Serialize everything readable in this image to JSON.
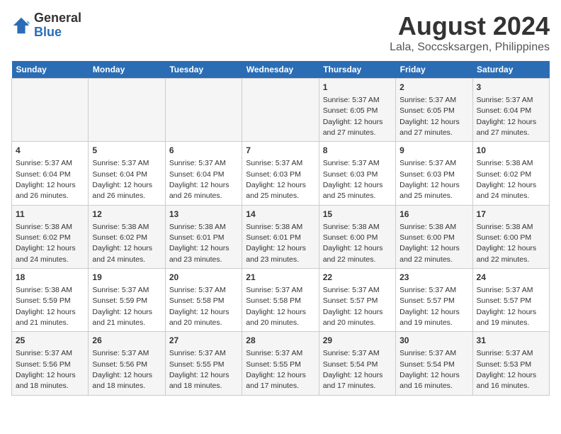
{
  "header": {
    "logo_general": "General",
    "logo_blue": "Blue",
    "title": "August 2024",
    "subtitle": "Lala, Soccsksargen, Philippines"
  },
  "weekdays": [
    "Sunday",
    "Monday",
    "Tuesday",
    "Wednesday",
    "Thursday",
    "Friday",
    "Saturday"
  ],
  "weeks": [
    [
      {
        "day": "",
        "info": ""
      },
      {
        "day": "",
        "info": ""
      },
      {
        "day": "",
        "info": ""
      },
      {
        "day": "",
        "info": ""
      },
      {
        "day": "1",
        "info": "Sunrise: 5:37 AM\nSunset: 6:05 PM\nDaylight: 12 hours and 27 minutes."
      },
      {
        "day": "2",
        "info": "Sunrise: 5:37 AM\nSunset: 6:05 PM\nDaylight: 12 hours and 27 minutes."
      },
      {
        "day": "3",
        "info": "Sunrise: 5:37 AM\nSunset: 6:04 PM\nDaylight: 12 hours and 27 minutes."
      }
    ],
    [
      {
        "day": "4",
        "info": "Sunrise: 5:37 AM\nSunset: 6:04 PM\nDaylight: 12 hours and 26 minutes."
      },
      {
        "day": "5",
        "info": "Sunrise: 5:37 AM\nSunset: 6:04 PM\nDaylight: 12 hours and 26 minutes."
      },
      {
        "day": "6",
        "info": "Sunrise: 5:37 AM\nSunset: 6:04 PM\nDaylight: 12 hours and 26 minutes."
      },
      {
        "day": "7",
        "info": "Sunrise: 5:37 AM\nSunset: 6:03 PM\nDaylight: 12 hours and 25 minutes."
      },
      {
        "day": "8",
        "info": "Sunrise: 5:37 AM\nSunset: 6:03 PM\nDaylight: 12 hours and 25 minutes."
      },
      {
        "day": "9",
        "info": "Sunrise: 5:37 AM\nSunset: 6:03 PM\nDaylight: 12 hours and 25 minutes."
      },
      {
        "day": "10",
        "info": "Sunrise: 5:38 AM\nSunset: 6:02 PM\nDaylight: 12 hours and 24 minutes."
      }
    ],
    [
      {
        "day": "11",
        "info": "Sunrise: 5:38 AM\nSunset: 6:02 PM\nDaylight: 12 hours and 24 minutes."
      },
      {
        "day": "12",
        "info": "Sunrise: 5:38 AM\nSunset: 6:02 PM\nDaylight: 12 hours and 24 minutes."
      },
      {
        "day": "13",
        "info": "Sunrise: 5:38 AM\nSunset: 6:01 PM\nDaylight: 12 hours and 23 minutes."
      },
      {
        "day": "14",
        "info": "Sunrise: 5:38 AM\nSunset: 6:01 PM\nDaylight: 12 hours and 23 minutes."
      },
      {
        "day": "15",
        "info": "Sunrise: 5:38 AM\nSunset: 6:00 PM\nDaylight: 12 hours and 22 minutes."
      },
      {
        "day": "16",
        "info": "Sunrise: 5:38 AM\nSunset: 6:00 PM\nDaylight: 12 hours and 22 minutes."
      },
      {
        "day": "17",
        "info": "Sunrise: 5:38 AM\nSunset: 6:00 PM\nDaylight: 12 hours and 22 minutes."
      }
    ],
    [
      {
        "day": "18",
        "info": "Sunrise: 5:38 AM\nSunset: 5:59 PM\nDaylight: 12 hours and 21 minutes."
      },
      {
        "day": "19",
        "info": "Sunrise: 5:37 AM\nSunset: 5:59 PM\nDaylight: 12 hours and 21 minutes."
      },
      {
        "day": "20",
        "info": "Sunrise: 5:37 AM\nSunset: 5:58 PM\nDaylight: 12 hours and 20 minutes."
      },
      {
        "day": "21",
        "info": "Sunrise: 5:37 AM\nSunset: 5:58 PM\nDaylight: 12 hours and 20 minutes."
      },
      {
        "day": "22",
        "info": "Sunrise: 5:37 AM\nSunset: 5:57 PM\nDaylight: 12 hours and 20 minutes."
      },
      {
        "day": "23",
        "info": "Sunrise: 5:37 AM\nSunset: 5:57 PM\nDaylight: 12 hours and 19 minutes."
      },
      {
        "day": "24",
        "info": "Sunrise: 5:37 AM\nSunset: 5:57 PM\nDaylight: 12 hours and 19 minutes."
      }
    ],
    [
      {
        "day": "25",
        "info": "Sunrise: 5:37 AM\nSunset: 5:56 PM\nDaylight: 12 hours and 18 minutes."
      },
      {
        "day": "26",
        "info": "Sunrise: 5:37 AM\nSunset: 5:56 PM\nDaylight: 12 hours and 18 minutes."
      },
      {
        "day": "27",
        "info": "Sunrise: 5:37 AM\nSunset: 5:55 PM\nDaylight: 12 hours and 18 minutes."
      },
      {
        "day": "28",
        "info": "Sunrise: 5:37 AM\nSunset: 5:55 PM\nDaylight: 12 hours and 17 minutes."
      },
      {
        "day": "29",
        "info": "Sunrise: 5:37 AM\nSunset: 5:54 PM\nDaylight: 12 hours and 17 minutes."
      },
      {
        "day": "30",
        "info": "Sunrise: 5:37 AM\nSunset: 5:54 PM\nDaylight: 12 hours and 16 minutes."
      },
      {
        "day": "31",
        "info": "Sunrise: 5:37 AM\nSunset: 5:53 PM\nDaylight: 12 hours and 16 minutes."
      }
    ]
  ]
}
